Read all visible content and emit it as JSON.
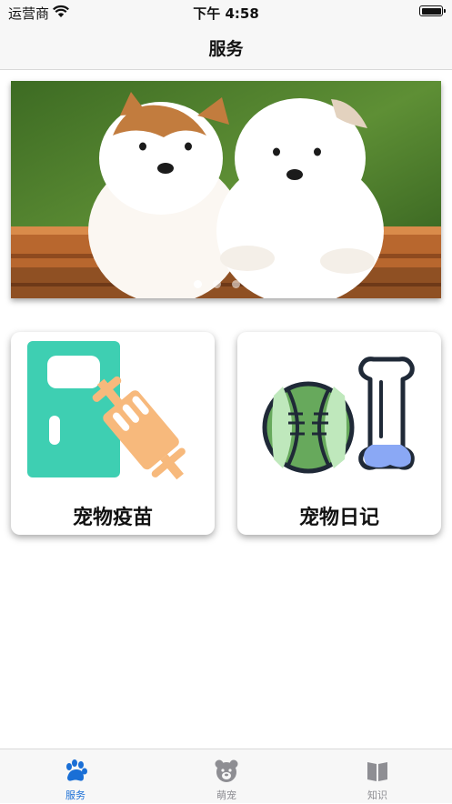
{
  "status_bar": {
    "carrier": "运营商",
    "time": "下午 4:58"
  },
  "nav": {
    "title": "服务"
  },
  "banner": {
    "description_icon": "puppies-photo",
    "page_count": 4,
    "active_page": 1
  },
  "cards": [
    {
      "label": "宠物疫苗",
      "icon": "vaccine-icon"
    },
    {
      "label": "宠物日记",
      "icon": "diary-ball-bone-icon"
    }
  ],
  "tabs": [
    {
      "label": "服务",
      "icon": "paw-icon",
      "active": true
    },
    {
      "label": "萌宠",
      "icon": "bear-icon",
      "active": false
    },
    {
      "label": "知识",
      "icon": "book-icon",
      "active": false
    }
  ],
  "colors": {
    "accent": "#1a6fd6",
    "inactive": "#8e8e93",
    "vaccine_green": "#3ecfb2",
    "syringe_orange": "#f7b97c",
    "ball_green": "#67a95c",
    "bone_blue": "#8aa8f5"
  }
}
